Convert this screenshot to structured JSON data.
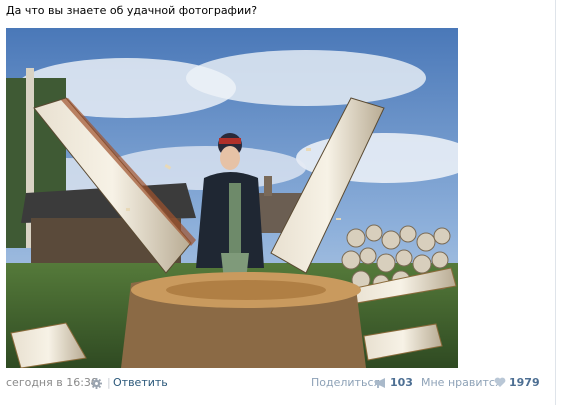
{
  "post": {
    "text": "Да что вы знаете об удачной фотографии?"
  },
  "photo": {
    "subject": "man-splitting-birch-log-photo"
  },
  "footer": {
    "date": "сегодня в 16:30",
    "separator": "|",
    "reply_label": "Ответить",
    "share_label": "Поделиться",
    "share_count": "103",
    "like_label": "Мне нравится",
    "like_count": "1979"
  },
  "colors": {
    "link": "#2b587a",
    "muted": "#8a8a8a",
    "action": "#8ea2b7",
    "count": "#4d6f93"
  },
  "icons": {
    "gear": "gear-icon",
    "share": "megaphone-icon",
    "like": "heart-icon"
  }
}
